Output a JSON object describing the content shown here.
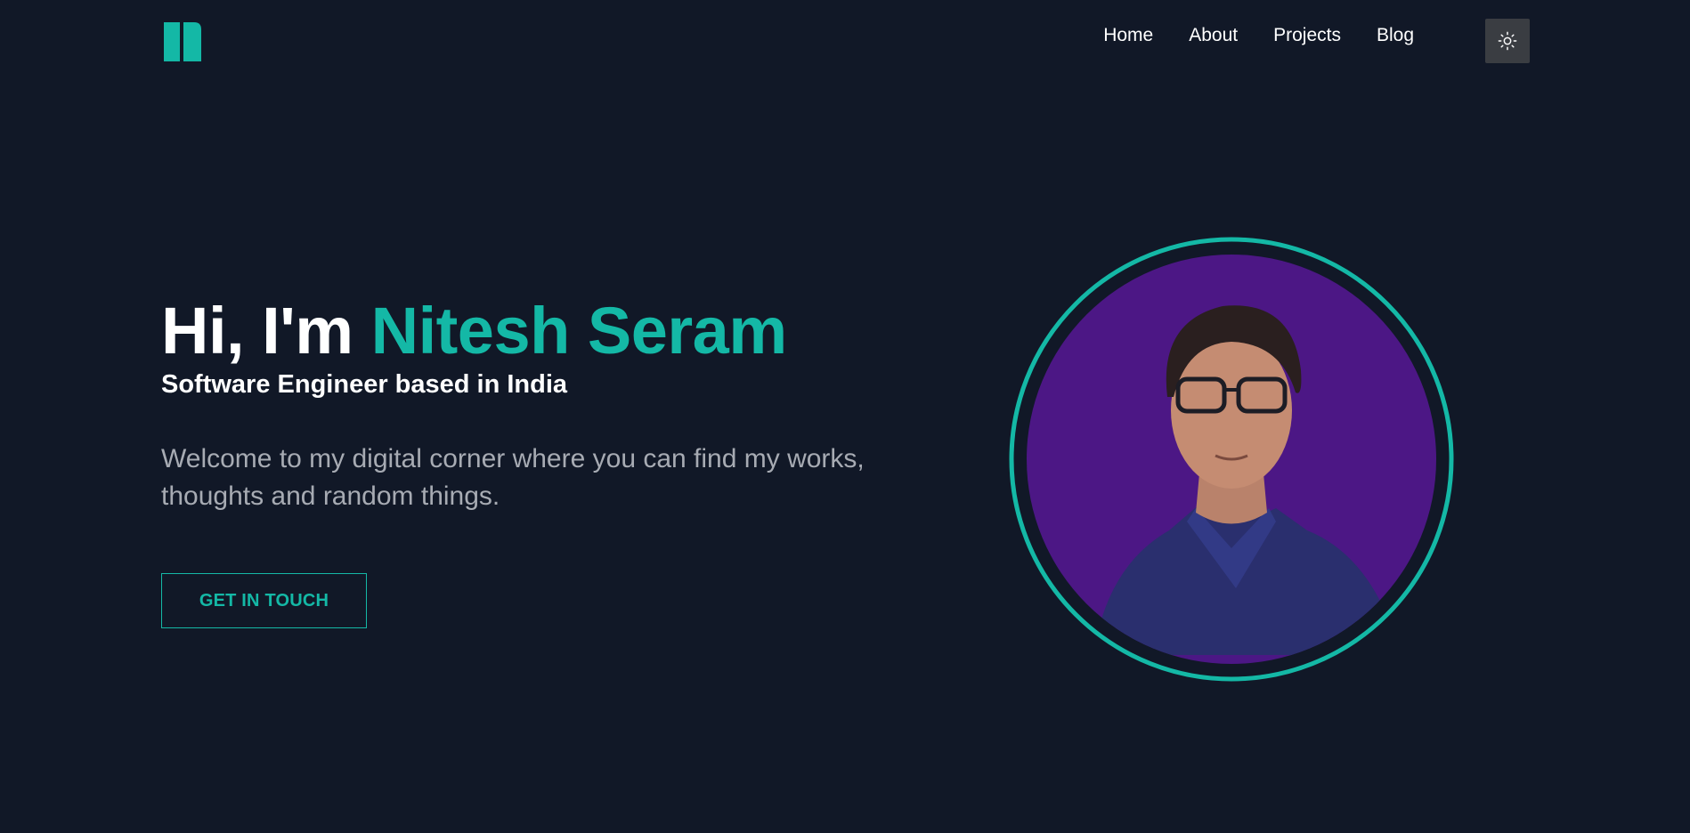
{
  "nav": {
    "logo_icon": "initials-logo",
    "links": [
      {
        "label": "Home"
      },
      {
        "label": "About"
      },
      {
        "label": "Projects"
      },
      {
        "label": "Blog"
      }
    ],
    "theme_toggle_icon": "sun-icon"
  },
  "hero": {
    "greeting": "Hi, I'm ",
    "name": "Nitesh Seram",
    "subtitle": "Software Engineer based in India",
    "description": "Welcome to my digital corner where you can find my works, thoughts and random things.",
    "cta_label": "GET IN TOUCH"
  },
  "colors": {
    "background": "#111827",
    "accent": "#14b8a6",
    "text": "#ffffff",
    "muted": "#a7abb3",
    "avatar_bg": "#4c1785",
    "theme_button": "#3a3d42"
  }
}
